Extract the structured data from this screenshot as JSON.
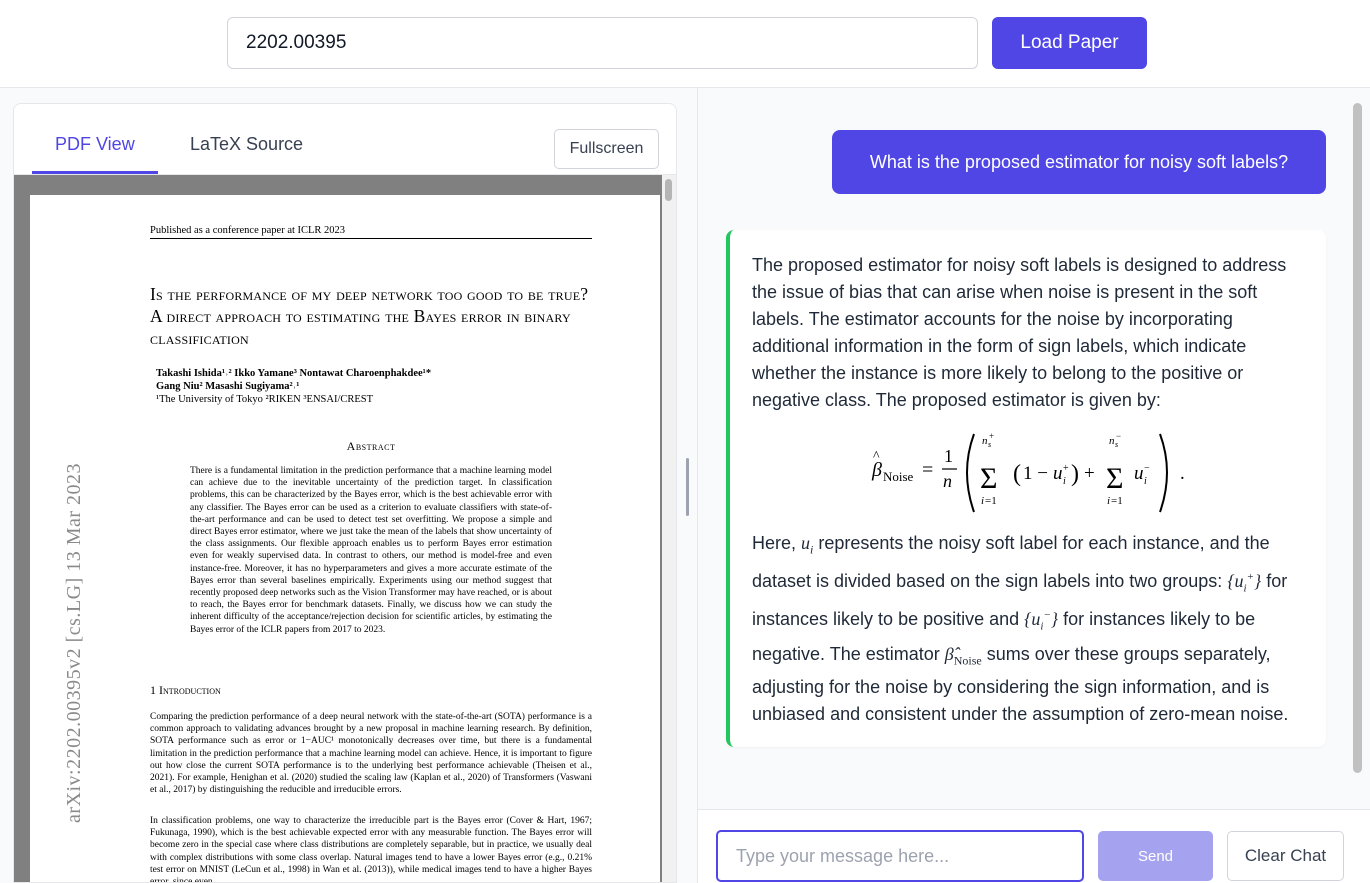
{
  "toolbar": {
    "paper_id_value": "2202.00395",
    "load_label": "Load Paper"
  },
  "viewer": {
    "tabs": [
      {
        "label": "PDF View",
        "active": true
      },
      {
        "label": "LaTeX Source",
        "active": false
      }
    ],
    "fullscreen_label": "Fullscreen"
  },
  "pdf": {
    "header": "Published as a conference paper at ICLR 2023",
    "title": "Is the performance of my deep network too good to be true? A direct approach to estimating the Bayes error in binary classification",
    "authors_line1": "Takashi Ishida¹˒²    Ikko Yamane³    Nontawat Charoenphakdee¹*",
    "authors_line2": "Gang Niu²    Masashi Sugiyama²˒¹",
    "affiliations": "¹The University of Tokyo   ²RIKEN   ³ENSAI/CREST",
    "abstract_heading": "Abstract",
    "abstract": "There is a fundamental limitation in the prediction performance that a machine learning model can achieve due to the inevitable uncertainty of the prediction target. In classification problems, this can be characterized by the Bayes error, which is the best achievable error with any classifier. The Bayes error can be used as a criterion to evaluate classifiers with state-of-the-art performance and can be used to detect test set overfitting. We propose a simple and direct Bayes error estimator, where we just take the mean of the labels that show uncertainty of the class assignments. Our flexible approach enables us to perform Bayes error estimation even for weakly supervised data. In contrast to others, our method is model-free and even instance-free. Moreover, it has no hyperparameters and gives a more accurate estimate of the Bayes error than several baselines empirically. Experiments using our method suggest that recently proposed deep networks such as the Vision Transformer may have reached, or is about to reach, the Bayes error for benchmark datasets. Finally, we discuss how we can study the inherent difficulty of the acceptance/rejection decision for scientific articles, by estimating the Bayes error of the ICLR papers from 2017 to 2023.",
    "intro_heading": "1   Introduction",
    "intro_p1": "Comparing the prediction performance of a deep neural network with the state-of-the-art (SOTA) performance is a common approach to validating advances brought by a new proposal in machine learning research. By definition, SOTA performance such as error or 1−AUC¹ monotonically decreases over time, but there is a fundamental limitation in the prediction performance that a machine learning model can achieve. Hence, it is important to figure out how close the current SOTA performance is to the underlying best performance achievable (Theisen et al., 2021). For example, Henighan et al. (2020) studied the scaling law (Kaplan et al., 2020) of Transformers (Vaswani et al., 2017) by distinguishing the reducible and irreducible errors.",
    "intro_p2": "In classification problems, one way to characterize the irreducible part is the Bayes error (Cover & Hart, 1967; Fukunaga, 1990), which is the best achievable expected error with any measurable function. The Bayes error will become zero in the special case where class distributions are completely separable, but in practice, we usually deal with complex distributions with some class overlap. Natural images tend to have a lower Bayes error (e.g., 0.21% test error on MNIST (LeCun et al., 1998) in Wan et al. (2013)), while medical images tend to have a higher Bayes error, since even",
    "arxiv_stamp": "arXiv:2202.00395v2  [cs.LG]  13 Mar 2023"
  },
  "chat": {
    "user_message": "What is the proposed estimator for noisy soft labels?",
    "assistant_p1": "The proposed estimator for noisy soft labels is designed to address the issue of bias that can arise when noise is present in the soft labels. The estimator accounts for the noise by incorporating additional information in the form of sign labels, which indicate whether the instance is more likely to belong to the positive or negative class. The proposed estimator is given by:",
    "assistant_p2_a": "Here, ",
    "assistant_p2_b": " represents the noisy soft label for each instance, and the dataset is divided based on the sign labels into two groups: ",
    "assistant_p2_c": " for instances likely to be positive and ",
    "assistant_p2_d": " for instances likely to be negative. The estimator ",
    "assistant_p2_e": " sums over these groups separately, adjusting for the noise by considering the sign information, and is unbiased and consistent under the assumption of zero-mean noise.",
    "input_placeholder": "Type your message here...",
    "send_label": "Send",
    "clear_label": "Clear Chat"
  },
  "colors": {
    "accent": "#4f46e5",
    "accent_disabled": "#a5a2f0",
    "assistant_border": "#22c55e"
  }
}
